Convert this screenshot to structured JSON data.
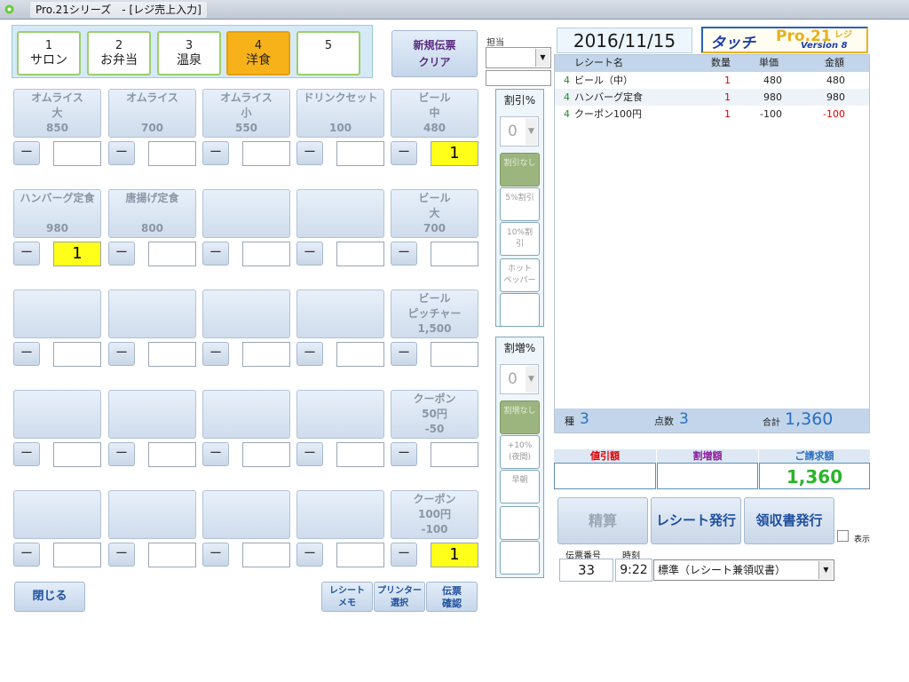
{
  "window": {
    "title": "Pro.21シリーズ　- [レジ売上入力]"
  },
  "categories": [
    {
      "num": "1",
      "label": "サロン"
    },
    {
      "num": "2",
      "label": "お弁当"
    },
    {
      "num": "3",
      "label": "温泉"
    },
    {
      "num": "4",
      "label": "洋食"
    },
    {
      "num": "5",
      "label": ""
    }
  ],
  "new_slip": {
    "line1": "新規伝票",
    "line2": "クリア"
  },
  "staff": {
    "label": "担当",
    "value": ""
  },
  "date": "2016/11/15",
  "logo": {
    "main": "タッチ",
    "brand": "Pro.21",
    "suffix": "レジ",
    "version": "Version 8"
  },
  "items": [
    [
      {
        "name": [
          "オムライス",
          "大"
        ],
        "price": "850",
        "qty": ""
      },
      {
        "name": [
          "オムライス"
        ],
        "price": "700",
        "qty": ""
      },
      {
        "name": [
          "オムライス",
          "小"
        ],
        "price": "550",
        "qty": ""
      },
      {
        "name": [
          "ドリンクセット"
        ],
        "price": "100",
        "qty": ""
      },
      {
        "name": [
          "ビール",
          "中"
        ],
        "price": "480",
        "qty": "1"
      }
    ],
    [
      {
        "name": [
          "ハンバーグ定食"
        ],
        "price": "980",
        "qty": "1"
      },
      {
        "name": [
          "唐揚げ定食"
        ],
        "price": "800",
        "qty": ""
      },
      {
        "name": [],
        "price": "",
        "qty": ""
      },
      {
        "name": [],
        "price": "",
        "qty": ""
      },
      {
        "name": [
          "ビール",
          "大"
        ],
        "price": "700",
        "qty": ""
      }
    ],
    [
      {
        "name": [],
        "price": "",
        "qty": ""
      },
      {
        "name": [],
        "price": "",
        "qty": ""
      },
      {
        "name": [],
        "price": "",
        "qty": ""
      },
      {
        "name": [],
        "price": "",
        "qty": ""
      },
      {
        "name": [
          "ビール",
          "ピッチャー"
        ],
        "price": "1,500",
        "qty": ""
      }
    ],
    [
      {
        "name": [],
        "price": "",
        "qty": ""
      },
      {
        "name": [],
        "price": "",
        "qty": ""
      },
      {
        "name": [],
        "price": "",
        "qty": ""
      },
      {
        "name": [],
        "price": "",
        "qty": ""
      },
      {
        "name": [
          "クーポン",
          "50円"
        ],
        "price": "-50",
        "qty": ""
      }
    ],
    [
      {
        "name": [],
        "price": "",
        "qty": ""
      },
      {
        "name": [],
        "price": "",
        "qty": ""
      },
      {
        "name": [],
        "price": "",
        "qty": ""
      },
      {
        "name": [],
        "price": "",
        "qty": ""
      },
      {
        "name": [
          "クーポン",
          "100円"
        ],
        "price": "-100",
        "qty": "1"
      }
    ]
  ],
  "minus_label": "ー",
  "discount": {
    "title": "割引%",
    "value": "0",
    "buttons": [
      [
        "割引なし"
      ],
      [
        "5%割引"
      ],
      [
        "10%割",
        "引"
      ],
      [
        "ホット",
        "ペッパー"
      ],
      [
        ""
      ]
    ]
  },
  "surcharge": {
    "title": "割増%",
    "value": "0",
    "buttons": [
      [
        "割増なし"
      ],
      [
        "+10%",
        "(夜間)"
      ],
      [
        "早朝"
      ],
      [
        ""
      ],
      [
        ""
      ]
    ]
  },
  "receipt": {
    "headers": [
      "レシート名",
      "数量",
      "単価",
      "金額"
    ],
    "rows": [
      {
        "cat": "4",
        "name": "ビール（中）",
        "qty": "1",
        "price": "480",
        "amount": "480"
      },
      {
        "cat": "4",
        "name": "ハンバーグ定食",
        "qty": "1",
        "price": "980",
        "amount": "980"
      },
      {
        "cat": "4",
        "name": "クーポン100円",
        "qty": "1",
        "price": "-100",
        "amount": "-100"
      }
    ],
    "footer": {
      "kinds_label": "種",
      "kinds": "3",
      "points_label": "点数",
      "points": "3",
      "total_label": "合計",
      "total": "1,360"
    }
  },
  "summary": {
    "discount_label": "値引額",
    "surcharge_label": "割増額",
    "bill_label": "ご請求額",
    "bill": "1,360"
  },
  "actions": {
    "settle": "精算",
    "receipt": "レシート発行",
    "invoice": "領収書発行",
    "show": "表示"
  },
  "slip": {
    "no_label": "伝票番号",
    "time_label": "時刻",
    "no": "33",
    "time": "9:22",
    "format": "標準（レシート兼領収書）"
  },
  "bottom": {
    "close": "閉じる",
    "memo": [
      "レシート",
      "メモ"
    ],
    "printer": [
      "プリンター",
      "選択"
    ],
    "slip_check": [
      "伝票",
      "確認"
    ]
  },
  "colors": {
    "highlight": "#ffff1a",
    "active_tab": "#f7b21a",
    "total": "#2a6fbf",
    "bill": "#2bb32b",
    "negative": "#e00000"
  }
}
